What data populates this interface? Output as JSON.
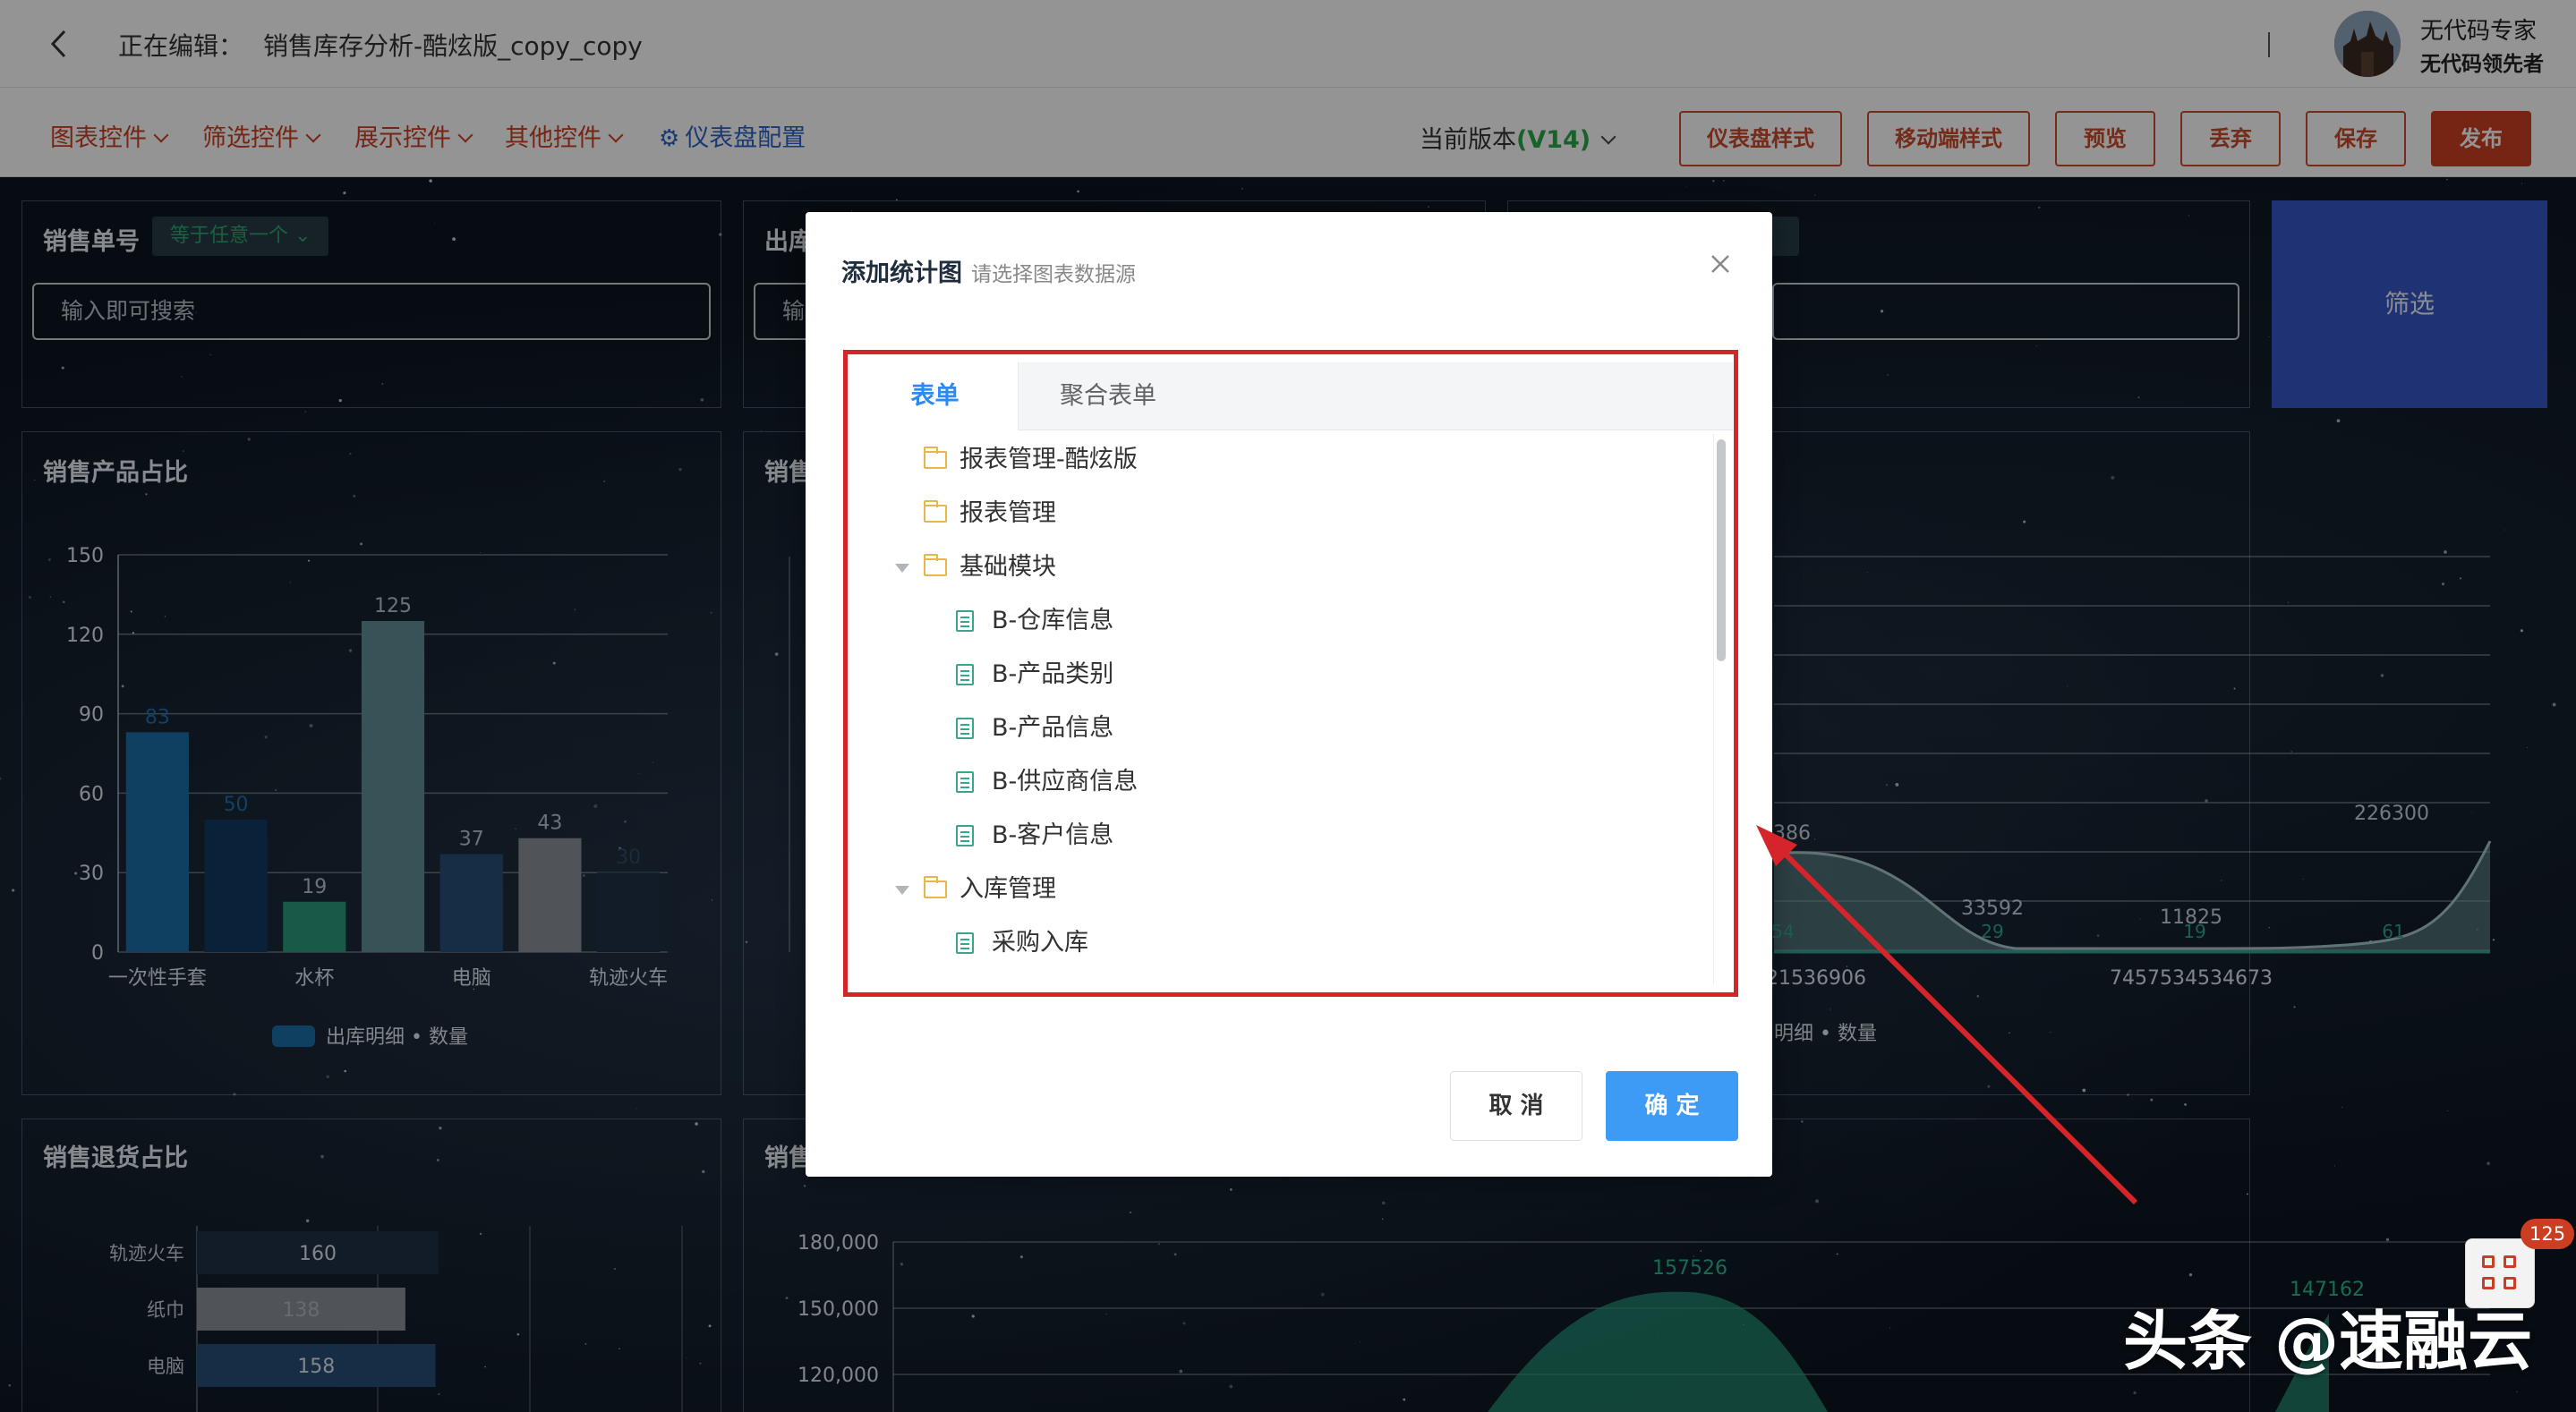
{
  "header": {
    "back_icon": "chevron-left-icon",
    "editing_label": "正在编辑：",
    "doc_name": "销售库存分析-酷炫版_copy_copy",
    "user_title": "无代码专家",
    "user_subtitle": "无代码领先者"
  },
  "toolbar": {
    "menus": [
      "图表控件",
      "筛选控件",
      "展示控件",
      "其他控件"
    ],
    "dashboard_config": "仪表盘配置",
    "version_label": "当前版本",
    "version_value": "(V14)",
    "buttons": {
      "dashboard_style": "仪表盘样式",
      "mobile_style": "移动端样式",
      "preview": "预览",
      "discard": "丢弃",
      "save": "保存",
      "publish": "发布"
    }
  },
  "dashboard": {
    "order_filter": {
      "title": "销售单号",
      "operator": "等于任意一个",
      "placeholder": "输入即可搜索"
    },
    "filter2": {
      "title": "出库",
      "placeholder": "输"
    },
    "filter_button": "筛选",
    "sales_share": {
      "title": "销售产品占比",
      "legend": "出库明细 • 数量"
    },
    "mid_panel_title": "销售",
    "mid_panel2_title": "销售",
    "right_chart": {
      "legend": "明细 • 数量",
      "x_labels": [
        "621536906",
        "7457534534673"
      ],
      "point_labels": [
        "99386",
        "33592",
        "11825",
        "226300"
      ],
      "small_labels": [
        "54",
        "29",
        "19",
        "61"
      ]
    },
    "returns": {
      "title": "销售退货占比"
    },
    "bottom_chart": {
      "y_ticks": [
        "180,000",
        "150,000",
        "120,000"
      ],
      "point_labels": [
        "157526",
        "147162"
      ]
    }
  },
  "chart_data": [
    {
      "type": "bar",
      "title": "销售产品占比",
      "categories": [
        "一次性手套",
        "",
        "水杯",
        "",
        "电脑",
        "",
        "轨迹火车"
      ],
      "values": [
        83,
        50,
        19,
        125,
        37,
        43,
        30
      ],
      "value_labels": [
        "83",
        "50",
        "19",
        "125",
        "37",
        "43",
        "30"
      ],
      "colors": [
        "#1a6fa8",
        "#103a62",
        "#2a9a7c",
        "#5f8f96",
        "#284e78",
        "#8a919a",
        "#1e3146"
      ],
      "series": [
        {
          "name": "出库明细 • 数量",
          "values": [
            83,
            50,
            19,
            125,
            37,
            43,
            30
          ]
        }
      ],
      "y_ticks": [
        "150",
        "120",
        "90",
        "60",
        "30",
        "0"
      ],
      "ylim": [
        0,
        150
      ],
      "grid": true,
      "legend": "bottom"
    },
    {
      "type": "bar",
      "orientation": "horizontal",
      "title": "销售退货占比",
      "categories": [
        "轨迹火车",
        "纸巾",
        "电脑"
      ],
      "values": [
        160,
        138,
        158
      ],
      "value_labels": [
        "160",
        "138",
        "158"
      ],
      "colors": [
        "#1e3146",
        "#8a919a",
        "#284e78"
      ]
    }
  ],
  "modal": {
    "title": "添加统计图",
    "subtitle": "请选择图表数据源",
    "close_icon": "close-icon",
    "tabs": [
      "表单",
      "聚合表单"
    ],
    "tree": [
      {
        "label": "报表管理-酷炫版",
        "type": "folder",
        "level": 0,
        "expanded": false
      },
      {
        "label": "报表管理",
        "type": "folder",
        "level": 0,
        "expanded": false
      },
      {
        "label": "基础模块",
        "type": "folder",
        "level": 0,
        "expanded": true
      },
      {
        "label": "B-仓库信息",
        "type": "form",
        "level": 1
      },
      {
        "label": "B-产品类别",
        "type": "form",
        "level": 1
      },
      {
        "label": "B-产品信息",
        "type": "form",
        "level": 1
      },
      {
        "label": "B-供应商信息",
        "type": "form",
        "level": 1
      },
      {
        "label": "B-客户信息",
        "type": "form",
        "level": 1
      },
      {
        "label": "入库管理",
        "type": "folder",
        "level": 0,
        "expanded": true
      },
      {
        "label": "采购入库",
        "type": "form",
        "level": 1
      }
    ],
    "cancel": "取 消",
    "confirm": "确 定"
  },
  "widget": {
    "badge": "125",
    "icon": "grid-icon"
  },
  "watermark": "头条 @速融云",
  "colors": {
    "accent": "#cc3e22",
    "link": "#2c62c8",
    "primary": "#3d9bf5",
    "highlight_box": "#d6252a"
  }
}
